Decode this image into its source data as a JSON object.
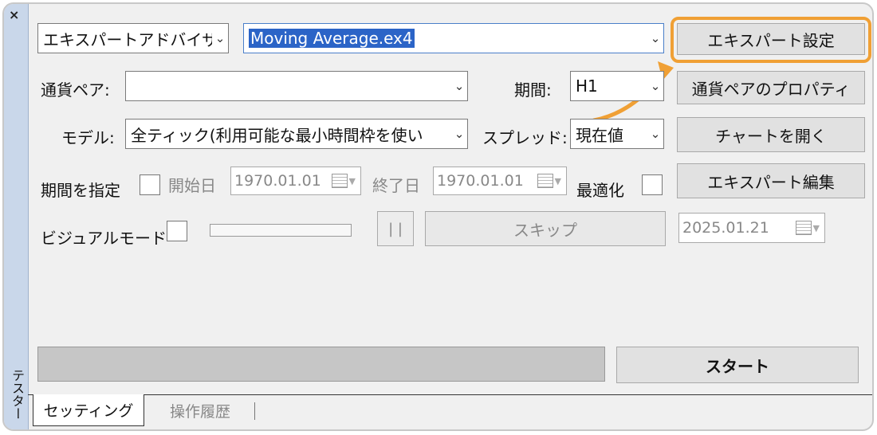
{
  "window": {
    "close_glyph": "×",
    "vertical_title": "テスター"
  },
  "row1": {
    "type_combo": "エキスパートアドバイザ",
    "expert_combo": "Moving Average.ex4",
    "expert_settings_button": "エキスパート設定"
  },
  "row2": {
    "symbol_label": "通貨ペア:",
    "symbol_value": "",
    "period_label": "期間:",
    "period_value": "H1",
    "symbol_props_button": "通貨ペアのプロパティ"
  },
  "row3": {
    "model_label": "モデル:",
    "model_value": "全ティック(利用可能な最小時間枠を使い",
    "spread_label": "スプレッド:",
    "spread_value": "現在値",
    "open_chart_button": "チャートを開く"
  },
  "row4": {
    "use_date_label": "期間を指定",
    "from_label": "開始日",
    "from_value": "1970.01.01",
    "to_label": "終了日",
    "to_value": "1970.01.01",
    "optimization_label": "最適化",
    "edit_expert_button": "エキスパート編集"
  },
  "row5": {
    "visual_label": "ビジュアルモード",
    "pause_label": "| |",
    "skip_button": "スキップ",
    "skip_date_value": "2025.01.21"
  },
  "bottom": {
    "start_button": "スタート"
  },
  "tabs": [
    {
      "label": "セッティング"
    },
    {
      "label": "操作履歴"
    }
  ],
  "colors": {
    "highlight": "#f0a035",
    "selection": "#2b64c7",
    "sidebar": "#c9d7ea"
  }
}
